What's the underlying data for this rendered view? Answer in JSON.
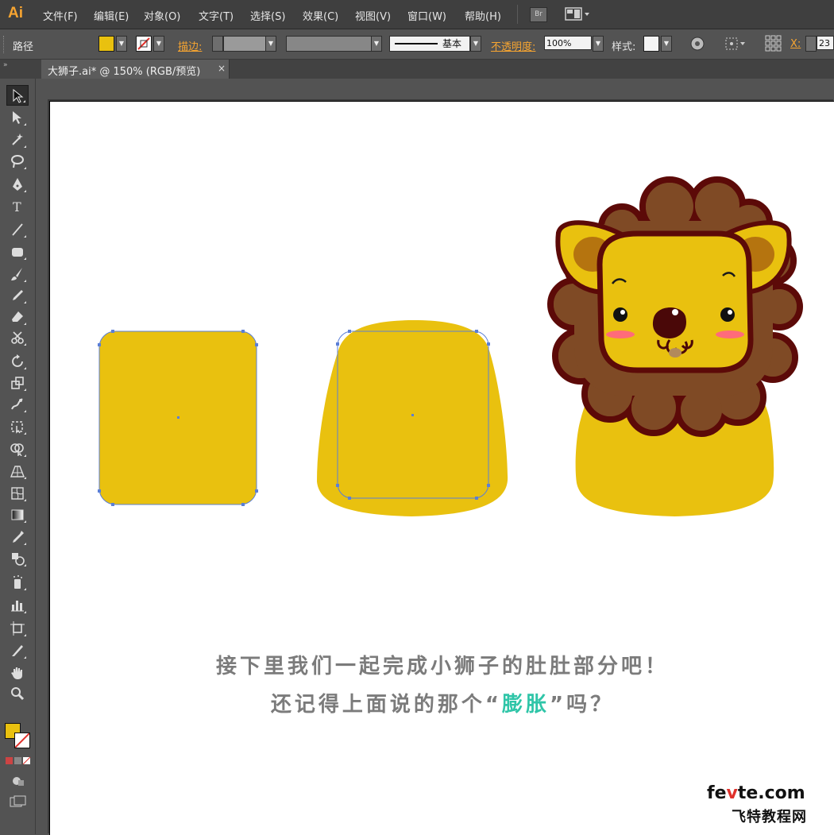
{
  "app": {
    "logo": "Ai"
  },
  "menu": [
    {
      "label": "文件(F)"
    },
    {
      "label": "编辑(E)"
    },
    {
      "label": "对象(O)"
    },
    {
      "label": "文字(T)"
    },
    {
      "label": "选择(S)"
    },
    {
      "label": "效果(C)"
    },
    {
      "label": "视图(V)"
    },
    {
      "label": "窗口(W)"
    },
    {
      "label": "帮助(H)"
    }
  ],
  "bridge_button": "Br",
  "control": {
    "object_type": "路径",
    "fill_color": "#e9c10f",
    "stroke_label": "描边:",
    "stroke_style_label": "基本",
    "opacity_label": "不透明度:",
    "opacity_value": "100%",
    "style_label": "样式:",
    "x_label": "X:",
    "x_value": "23"
  },
  "document": {
    "tab_title": "大狮子.ai* @ 150% (RGB/预览)",
    "close_glyph": "×"
  },
  "tools": [
    {
      "name": "selection-tool"
    },
    {
      "name": "direct-selection-tool"
    },
    {
      "name": "magic-wand-tool"
    },
    {
      "name": "lasso-tool"
    },
    {
      "name": "pen-tool"
    },
    {
      "name": "type-tool"
    },
    {
      "name": "line-tool"
    },
    {
      "name": "rectangle-tool"
    },
    {
      "name": "paintbrush-tool"
    },
    {
      "name": "pencil-tool"
    },
    {
      "name": "eraser-tool"
    },
    {
      "name": "scissors-tool"
    },
    {
      "name": "rotate-tool"
    },
    {
      "name": "scale-tool"
    },
    {
      "name": "warp-tool"
    },
    {
      "name": "free-transform-tool"
    },
    {
      "name": "shape-builder-tool"
    },
    {
      "name": "perspective-grid-tool"
    },
    {
      "name": "mesh-tool"
    },
    {
      "name": "gradient-tool"
    },
    {
      "name": "eyedropper-tool"
    },
    {
      "name": "blend-tool"
    },
    {
      "name": "symbol-sprayer-tool"
    },
    {
      "name": "column-graph-tool"
    },
    {
      "name": "artboard-tool"
    },
    {
      "name": "slice-tool"
    },
    {
      "name": "hand-tool"
    },
    {
      "name": "zoom-tool"
    }
  ],
  "colors": {
    "body_yellow": "#e9c10f",
    "mane_brown": "#7f4a25",
    "outline_dark": "#5c0a08",
    "ear_inner": "#b5740f",
    "cheek_pink": "#ff6b7a",
    "tongue": "#b28a5c",
    "selection_blue": "#5b7fd6",
    "highlight_teal": "#2fc5a8"
  },
  "caption": {
    "line1": "接下里我们一起完成小狮子的肚肚部分吧！",
    "line2_before": "还记得上面说的那个“",
    "line2_highlight": "膨胀",
    "line2_after": "”吗？"
  },
  "watermark": {
    "site_pre": "fe",
    "site_v": "v",
    "site_post": "te.com",
    "name": "飞特教程网"
  }
}
